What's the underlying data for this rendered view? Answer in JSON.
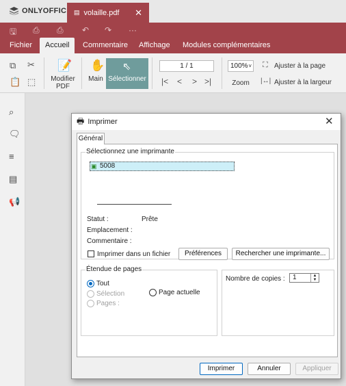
{
  "app": {
    "name": "ONLYOFFICE",
    "file_tab": "volaille.pdf"
  },
  "menu": [
    "Fichier",
    "Accueil",
    "Commentaire",
    "Affichage",
    "Modules complémentaires"
  ],
  "ribbon": {
    "modify_pdf": "Modifier PDF",
    "hand": "Main",
    "select": "Sélectionner",
    "page_field": "1 / 1",
    "zoom_value": "100%",
    "zoom_label": "Zoom",
    "fit_page": "Ajuster à la page",
    "fit_width": "Ajuster à la largeur"
  },
  "dialog": {
    "title": "Imprimer",
    "tab": "Général",
    "group_printer": "Sélectionnez une imprimante",
    "printer_selected": "5008",
    "status_label": "Statut :",
    "status_value": "Prête",
    "location_label": "Emplacement :",
    "comment_label": "Commentaire :",
    "print_to_file": "Imprimer dans un fichier",
    "preferences": "Préférences",
    "find_printer": "Rechercher une imprimante...",
    "group_range": "Étendue de pages",
    "range_all": "Tout",
    "range_selection": "Sélection",
    "range_current": "Page actuelle",
    "range_pages": "Pages :",
    "copies_label": "Nombre de copies :",
    "copies_value": "1",
    "print_button": "Imprimer",
    "cancel_button": "Annuler",
    "apply_button": "Appliquer"
  }
}
